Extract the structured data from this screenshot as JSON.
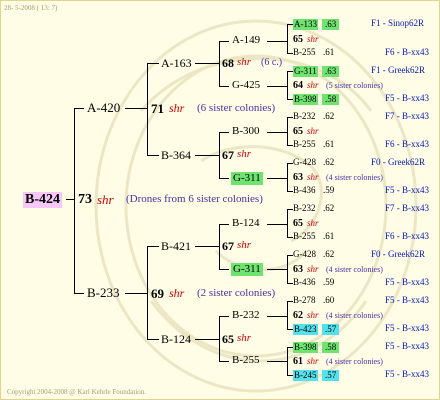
{
  "header": {
    "date": "28- 5-2008 ( 13: 7)"
  },
  "footer": {
    "copyright": "Copyright 2004-2008 @ Karl Kehrle Foundation."
  },
  "root": {
    "id": "B-424",
    "gen_num": "73",
    "gen_shr": "shr",
    "note": "(Drones from 6 sister colonies)"
  },
  "level1": [
    {
      "id": "A-420",
      "gen_num": "71",
      "gen_shr": "shr",
      "note": "(6 sister colonies)"
    },
    {
      "id": "B-233",
      "gen_num": "69",
      "gen_shr": "shr",
      "note": "(2 sister colonies)"
    }
  ],
  "level2": [
    {
      "id": "A-163",
      "gen_num": "68",
      "gen_shr": "shr",
      "note": "(6 c.)"
    },
    {
      "id": "B-364",
      "gen_num": "67",
      "gen_shr": "shr"
    },
    {
      "id": "B-421",
      "gen_num": "67",
      "gen_shr": "shr"
    },
    {
      "id": "B-124",
      "gen_num": "65",
      "gen_shr": "shr"
    }
  ],
  "level3": [
    {
      "id": "A-149",
      "gen_num": "65",
      "gen_shr": "shr"
    },
    {
      "id": "G-425",
      "gen_num": "64",
      "gen_shr": "shr",
      "note": "(5 sister colonies)"
    },
    {
      "id": "B-300",
      "gen_num": "65",
      "gen_shr": "shr"
    },
    {
      "id": "G-311",
      "gen_num": "63",
      "gen_shr": "shr",
      "note": "(4 sister colonies)"
    },
    {
      "id": "B-124",
      "gen_num": "65",
      "gen_shr": "shr"
    },
    {
      "id": "G-311",
      "gen_num": "63",
      "gen_shr": "shr",
      "note": "(4 sister colonies)"
    },
    {
      "id": "B-232",
      "gen_num": "62",
      "gen_shr": "shr",
      "note": "(4 sister colonies)"
    },
    {
      "id": "B-255",
      "gen_num": "61",
      "gen_shr": "shr",
      "note": "(4 sister colonies)"
    }
  ],
  "level4": [
    {
      "id": "A-133",
      "val": ".63",
      "ref": "F1 - Sinop62R"
    },
    {
      "id": "B-255",
      "val": ".61",
      "ref": "F6 - B-xx43"
    },
    {
      "id": "G-311",
      "val": ".63",
      "ref": "F1 - Greek62R"
    },
    {
      "id": "B-398",
      "val": ".58",
      "ref": "F5 - B-xx43"
    },
    {
      "id": "B-232",
      "val": ".62",
      "ref": "F7 - B-xx43"
    },
    {
      "id": "B-255",
      "val": ".61",
      "ref": "F6 - B-xx43"
    },
    {
      "id": "G-428",
      "val": ".62",
      "ref": "F0 - Greek62R"
    },
    {
      "id": "B-436",
      "val": ".59",
      "ref": "F5 - B-xx43"
    },
    {
      "id": "B-232",
      "val": ".62",
      "ref": "F7 - B-xx43"
    },
    {
      "id": "B-255",
      "val": ".61",
      "ref": "F6 - B-xx43"
    },
    {
      "id": "G-428",
      "val": ".62",
      "ref": "F0 - Greek62R"
    },
    {
      "id": "B-436",
      "val": ".59",
      "ref": "F5 - B-xx43"
    },
    {
      "id": "B-278",
      "val": ".60",
      "ref": "F5 - B-xx43"
    },
    {
      "id": "B-423",
      "val": ".57",
      "ref": "F5 - B-xx43"
    },
    {
      "id": "B-398",
      "val": ".58",
      "ref": "F5 - B-xx43"
    },
    {
      "id": "B-245",
      "val": ".57",
      "ref": "F5 - B-xx43"
    }
  ],
  "colors": {
    "background": "#fffde6",
    "highlight_green": "#6fe36f",
    "highlight_cyan": "#53e1ec",
    "highlight_pink": "#f7c8f7",
    "generation_shr": "#d00000",
    "note_text": "#4a30a6",
    "ref_text": "#0018c0"
  }
}
